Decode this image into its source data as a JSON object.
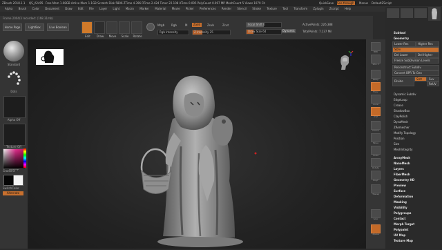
{
  "title_bar": {
    "app": "ZBrush 2018.1.1",
    "project": "QS_A2495",
    "stats": "Free Mem 1.08GB  Active Mem 1.1GB  Scratch Disk 5806  ZTime 4.396  RTime 2.424  Timer 22.108  ATime 0.095  PolyCount 0.097 MP  MeshCount 5  Views 1079 Ch",
    "quicksave": "QuickSave",
    "see_through": "See-through 0",
    "menus_label": "Menus",
    "default_zscript": "DefaultZScript"
  },
  "menu_bar": {
    "items": [
      "Alpha",
      "Brush",
      "Color",
      "Document",
      "Draw",
      "Edit",
      "File",
      "Layer",
      "Light",
      "Macro",
      "Marker",
      "Material",
      "Movie",
      "Picker",
      "Preferences",
      "Render",
      "Stencil",
      "Stroke",
      "Texture",
      "Tool",
      "Transform",
      "Zplugin",
      "Zscript",
      "Help"
    ]
  },
  "mesh_readout": "Frame 2004/3 recorded: (168.31mb)",
  "top_shelf": {
    "buttons": [
      "Home Page",
      "LightBox",
      "Live Boolean"
    ],
    "modes": [
      "Edit",
      "Draw",
      "Move",
      "Scale",
      "Rotate"
    ],
    "mrgb": "Mrgb",
    "rgb": "Rgb",
    "m": "M",
    "zadd": "Zadd",
    "zsub": "Zsub",
    "zcut": "Zcut",
    "rgb_intensity": "Rgb Intensity",
    "z_intensity": "Z Intensity 25",
    "focal_shift": "Focal Shift 0",
    "draw_size": "Draw Size 64",
    "dynamic": "Dynamic",
    "active_points": "ActivePoints: 226,388",
    "total_points": "TotalPoints: 7.137 Mil"
  },
  "left_tray": {
    "brush_name": "Standard",
    "stroke_name": "Dots",
    "alpha_name": "Alpha Off",
    "texture_name": "Texture Off",
    "material_name": "Matcap",
    "gradient_label": "Gradient",
    "switch_color_label": "SwitchColor",
    "alternate_label": "Alternate"
  },
  "right_shelf": {
    "labels": [
      "BPR",
      "SPix 3",
      "Persp",
      "Floor",
      "Local",
      "XYZ",
      "Frame",
      "Move",
      "Scale",
      "Rotate",
      "PolyF",
      "Transp",
      "Solo",
      "Xpose"
    ]
  },
  "right_panel": {
    "tool_thumbs": [
      "PolyMesh3D",
      "Cylinder3D",
      "SimpleBrush",
      "Scrapelfigurine"
    ],
    "subtool": "Subtool",
    "geometry": "Geometry",
    "lower_res": "Lower Res",
    "higher_res": "Higher Res",
    "sdiv": "SDiv",
    "del_lower": "Del Lower",
    "del_higher": "Del Higher",
    "freeze": "Freeze SubDivision Levels",
    "reconstruct": "Reconstruct Subdiv",
    "convert_bpr": "Convert BPR To Geo",
    "divide": "Divide",
    "smt": "Smt",
    "suv": "Suv",
    "rsmt": "ReUV",
    "items": [
      "Dynamic Subdiv",
      "EdgeLoop",
      "Crease",
      "ShadowBox",
      "ClayPolish",
      "DynaMesh",
      "ZRemesher",
      "Modify Topology",
      "Position",
      "Size",
      "MeshIntegrity"
    ],
    "items2": [
      "ArrayMesh",
      "NanoMesh",
      "Layers",
      "FiberMesh",
      "Geometry HD",
      "Preview",
      "Surface",
      "Deformation",
      "Masking",
      "Visibility",
      "Polygroups",
      "Contact",
      "Morph Target",
      "Polypaint",
      "UV Map",
      "Texture Map"
    ]
  },
  "colors": {
    "accent_orange": "#d07a2a",
    "panel_dark": "#2a2a2a",
    "shelf": "#343434"
  }
}
